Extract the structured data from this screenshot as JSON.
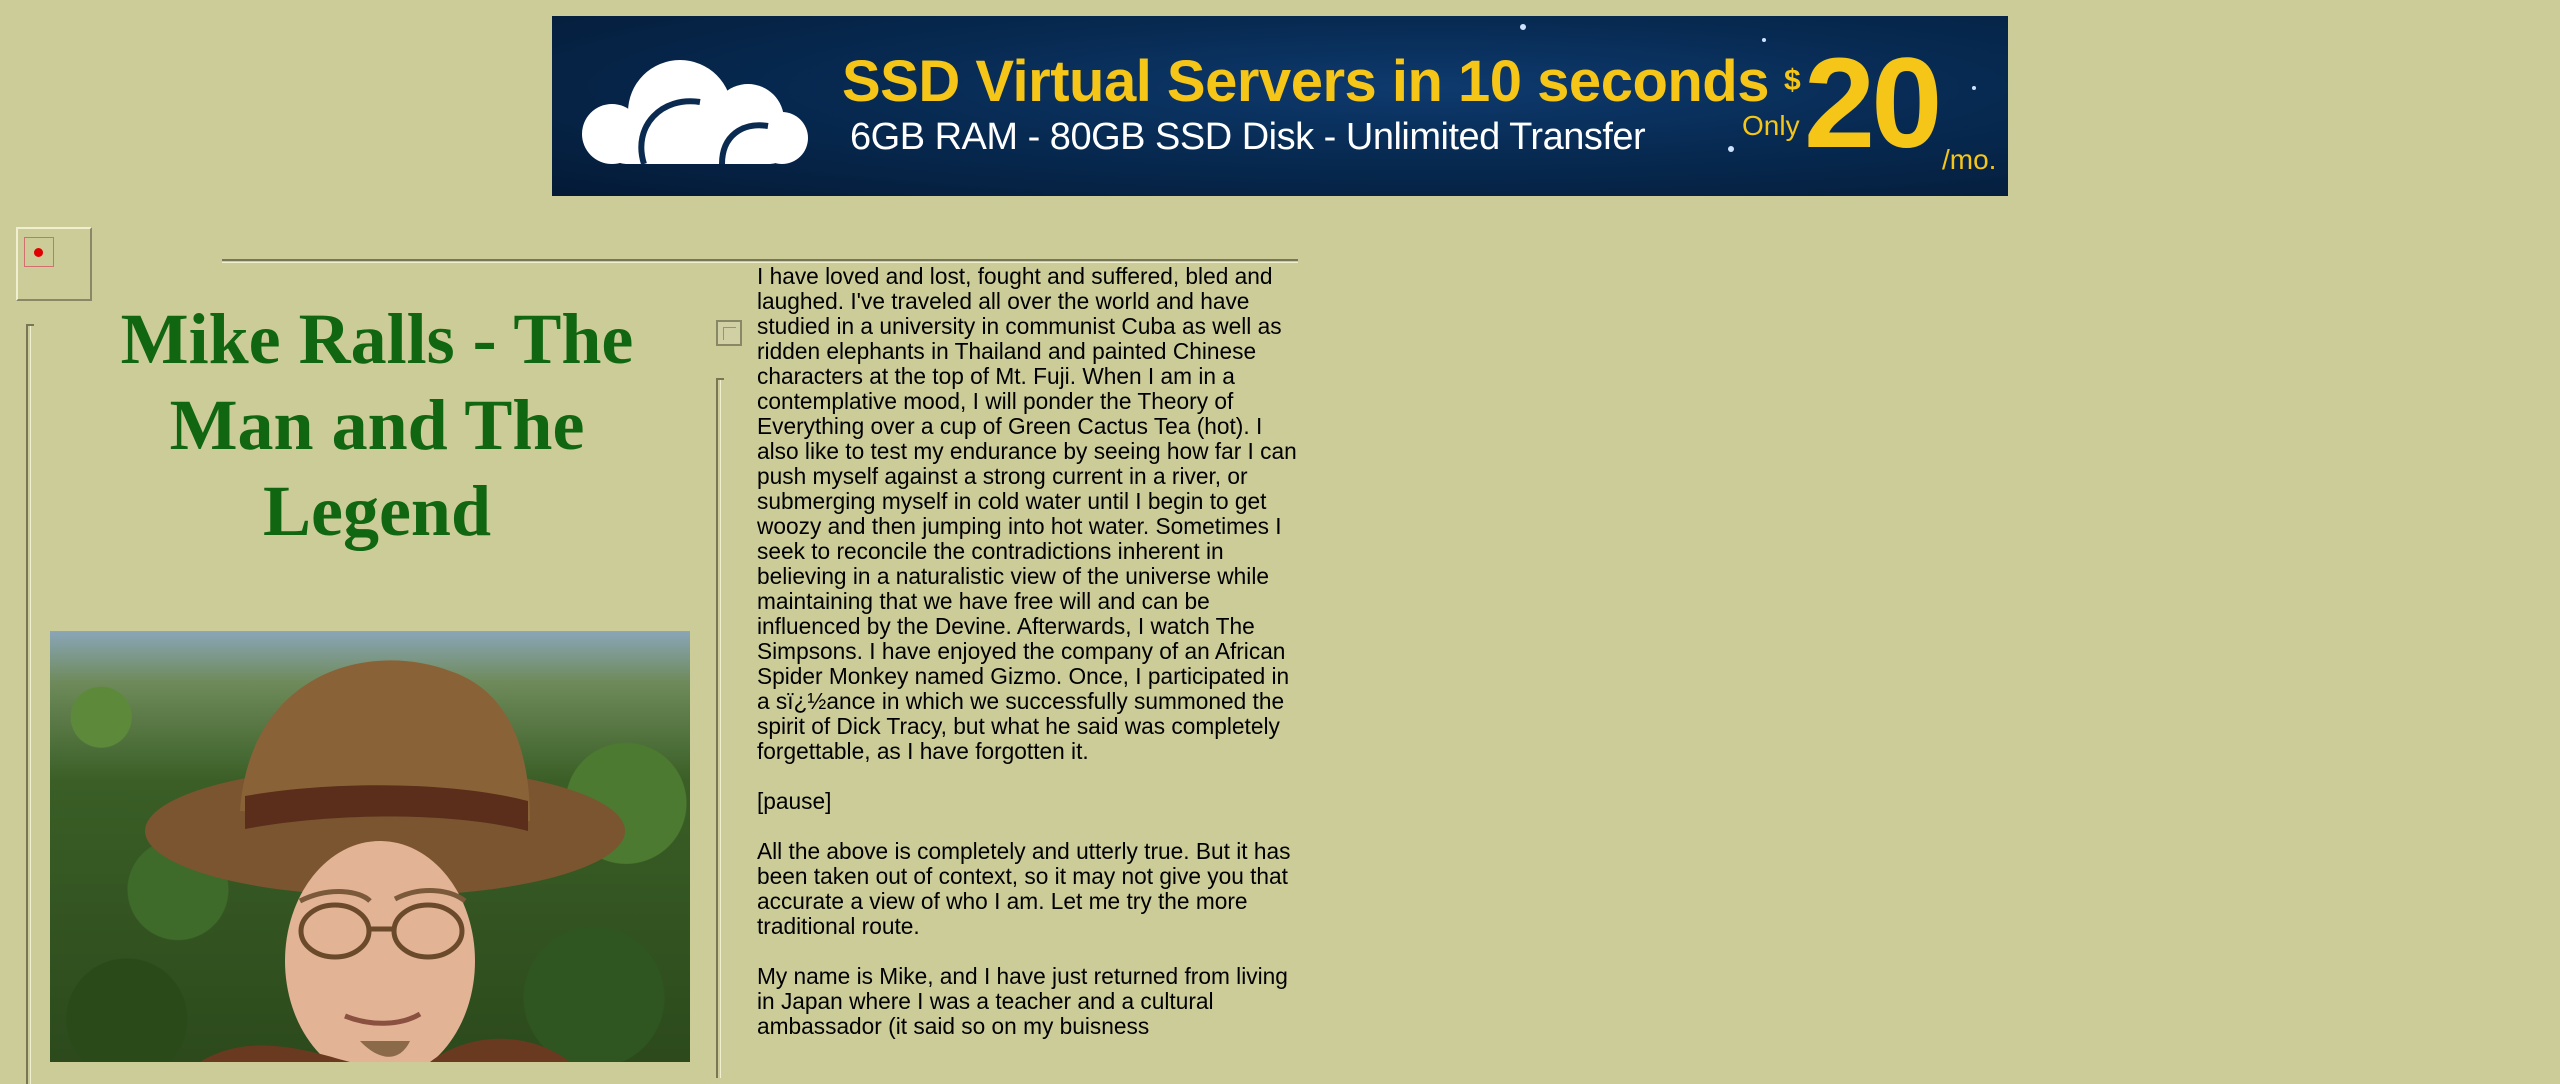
{
  "banner": {
    "headline": "SSD Virtual Servers in 10 seconds",
    "subline": "6GB RAM  - 80GB SSD Disk - Unlimited Transfer",
    "only": "Only",
    "currency": "$",
    "price": "20",
    "period": "/mo.",
    "colors": {
      "background": "#072a52",
      "accent": "#f5c518",
      "text": "#ffffff"
    }
  },
  "page": {
    "title": "Mike Ralls - The Man and The Legend",
    "title_color": "#116611",
    "background": "#cccc99",
    "portrait_icon": "portrait-photo",
    "broken_image_icon": "broken-image-icon"
  },
  "content": {
    "paragraphs": [
      "I have loved and lost, fought and suffered, bled and laughed. I've traveled all over the world and have studied in a university in communist Cuba as well as ridden elephants in Thailand and painted Chinese characters at the top of Mt. Fuji.  When I am in a contemplative mood, I will ponder the Theory of Everything over a cup of Green Cactus Tea (hot). I also like to test my endurance by seeing how far I can push myself against a strong current in a river, or submerging myself in cold water until I begin to get woozy and then jumping into hot water. Sometimes I seek to reconcile the contradictions inherent in believing in a naturalistic view of the universe while maintaining that we have free will and can be influenced by the Devine. Afterwards, I watch The Simpsons. I have enjoyed the company of an African Spider Monkey named Gizmo. Once, I participated in a sï¿½ance in which we successfully summoned the spirit of Dick Tracy, but what he said was completely forgettable, as I have forgotten it.",
      "[pause]",
      "All the above is completely and utterly true.  But it has been taken out of context, so it may not give you that accurate a view of who I am.  Let me try the more traditional route.",
      "My name is Mike, and I have just returned from living in Japan where I was a teacher and a cultural ambassador (it said so on my buisness"
    ]
  }
}
